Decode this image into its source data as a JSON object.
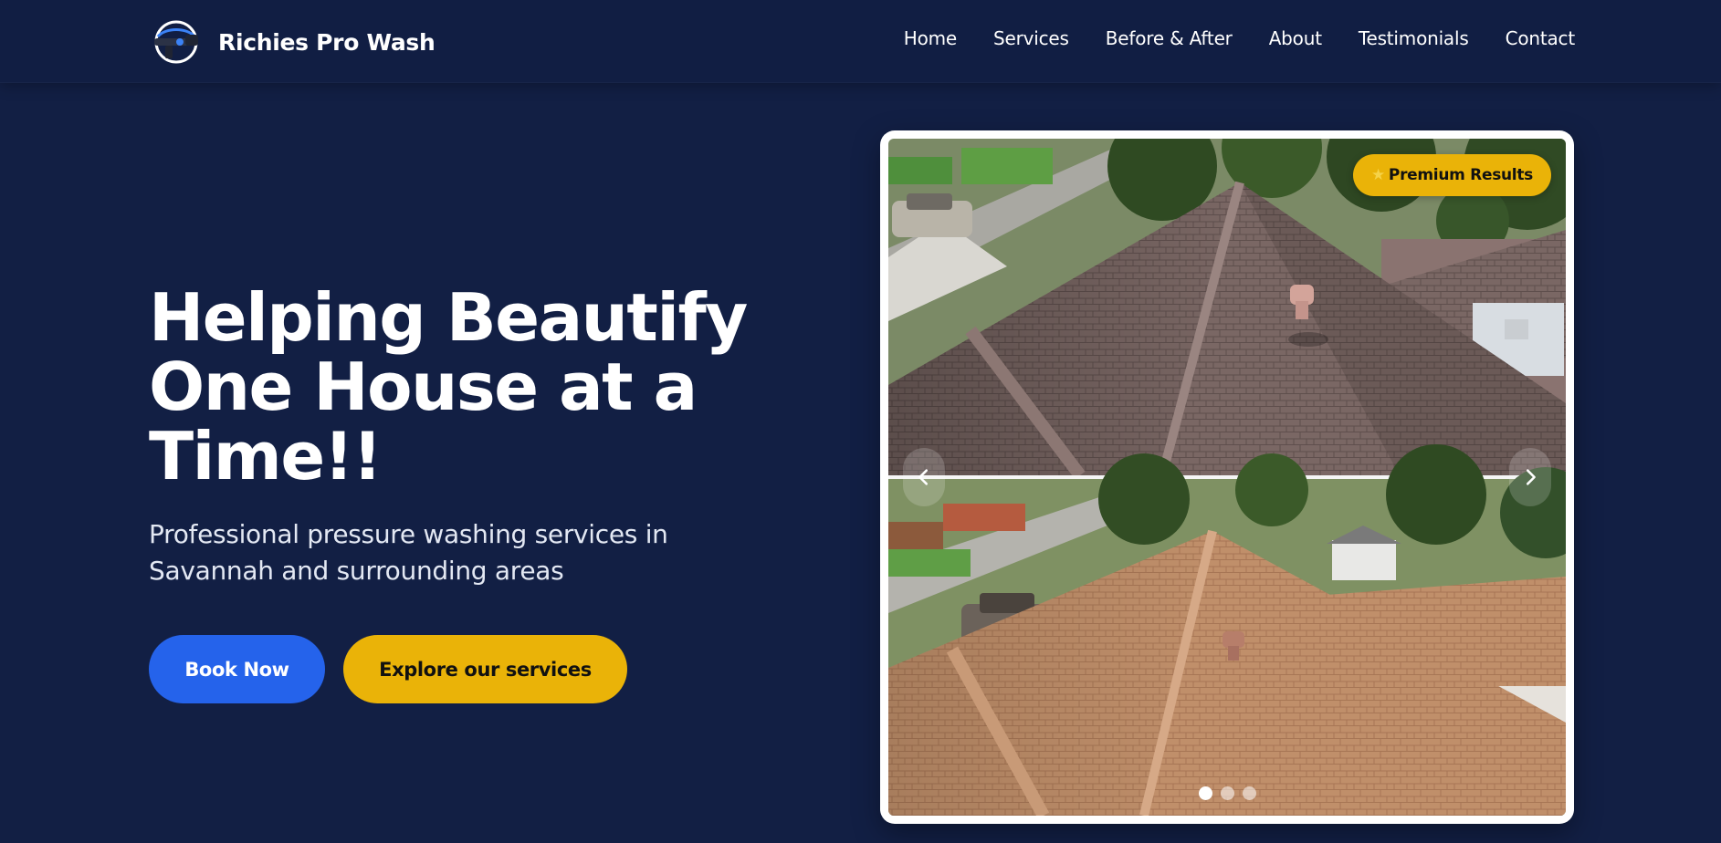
{
  "brand": {
    "name": "Richies Pro Wash"
  },
  "nav": {
    "items": [
      "Home",
      "Services",
      "Before & After",
      "About",
      "Testimonials",
      "Contact"
    ]
  },
  "hero": {
    "title_lines": [
      "Helping Beautify",
      "One House at a",
      "Time!!"
    ],
    "subtitle_lines": [
      "Professional pressure washing services in",
      "Savannah and surrounding areas"
    ],
    "book_button": "Book Now",
    "explore_button": "Explore our services"
  },
  "carousel": {
    "badge_icon": "star-icon",
    "badge_text": "Premium Results",
    "slide_count": 3,
    "active_slide": 1
  },
  "colors": {
    "background": "#121f44",
    "primary_blue": "#2563eb",
    "accent_yellow": "#eab308"
  }
}
